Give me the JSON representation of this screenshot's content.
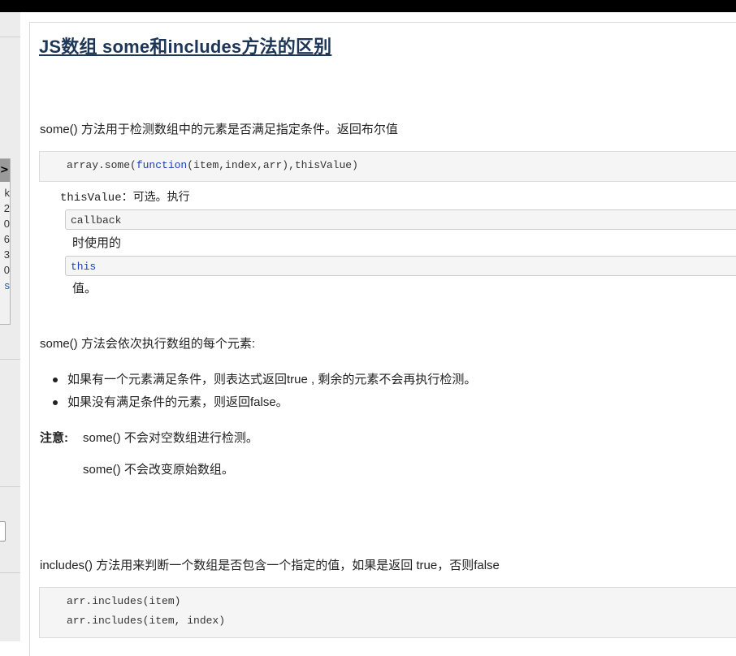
{
  "left_panel": {
    "header": ">",
    "rows": [
      "k",
      "2",
      "0",
      "6",
      "3",
      "0",
      "s"
    ]
  },
  "article": {
    "title": "JS数组 some和includes方法的区别",
    "some_intro": "some() 方法用于检测数组中的元素是否满足指定条件。返回布尔值",
    "some_syntax": {
      "prefix": "array.some(",
      "keyword": "function",
      "suffix": "(item,index,arr),thisValue)"
    },
    "this_value_note": "thisValue：可选。执行",
    "callback_code": "callback",
    "used_when": "时使用的",
    "this_code": "this",
    "value_suffix": "值。",
    "some_behavior": "some() 方法会依次执行数组的每个元素:",
    "bullets": [
      "如果有一个元素满足条件，则表达式返回true , 剩余的元素不会再执行检测。",
      "如果没有满足条件的元素，则返回false。"
    ],
    "note_label": "注意:",
    "note_lines": [
      "some() 不会对空数组进行检测。",
      "some() 不会改变原始数组。"
    ],
    "includes_intro": "includes() 方法用来判断一个数组是否包含一个指定的值，如果是返回 true，否则false",
    "includes_code": [
      "arr.includes(item)",
      "arr.includes(item, index)"
    ]
  }
}
